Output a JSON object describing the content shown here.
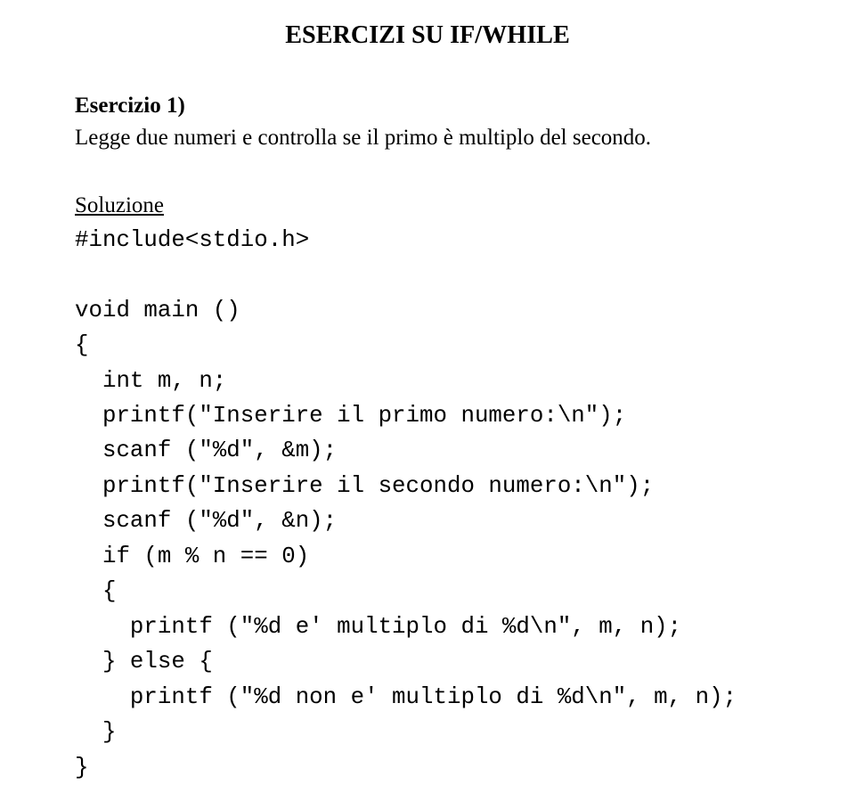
{
  "title": "ESERCIZI SU IF/WHILE",
  "exercise": {
    "heading": "Esercizio 1)",
    "body": "Legge due numeri e controlla se il primo è multiplo del secondo."
  },
  "solution_label": "Soluzione",
  "code": {
    "l1": "#include<stdio.h>",
    "l2": "",
    "l3": "void main ()",
    "l4": "{",
    "l5": "  int m, n;",
    "l6": "  printf(\"Inserire il primo numero:\\n\");",
    "l7": "  scanf (\"%d\", &m);",
    "l8": "  printf(\"Inserire il secondo numero:\\n\");",
    "l9": "  scanf (\"%d\", &n);",
    "l10": "  if (m % n == 0)",
    "l11": "  {",
    "l12": "    printf (\"%d e' multiplo di %d\\n\", m, n);",
    "l13": "  } else {",
    "l14": "    printf (\"%d non e' multiplo di %d\\n\", m, n);",
    "l15": "  }",
    "l16": "}"
  }
}
